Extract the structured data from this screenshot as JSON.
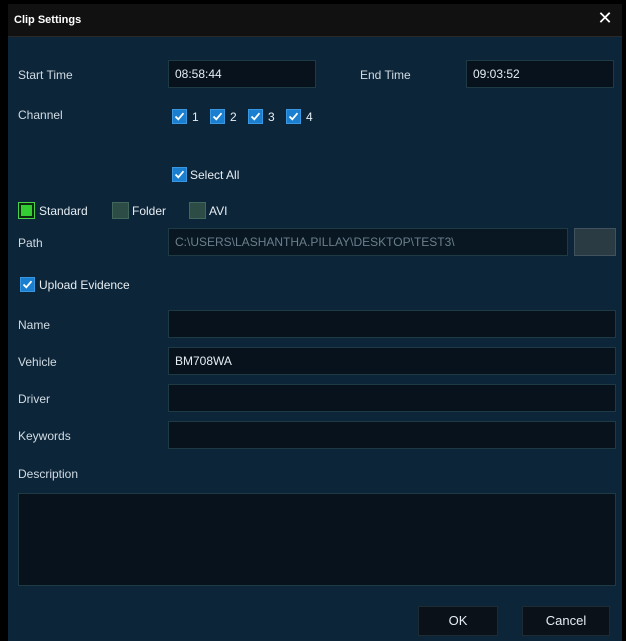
{
  "dialog": {
    "title": "Clip Settings"
  },
  "time": {
    "start_label": "Start Time",
    "start_value": "08:58:44",
    "end_label": "End Time",
    "end_value": "09:03:52"
  },
  "channel": {
    "label": "Channel",
    "items": [
      {
        "label": "1",
        "checked": true
      },
      {
        "label": "2",
        "checked": true
      },
      {
        "label": "3",
        "checked": true
      },
      {
        "label": "4",
        "checked": true
      }
    ],
    "select_all_label": "Select All"
  },
  "format": {
    "options": [
      {
        "label": "Standard",
        "selected": true
      },
      {
        "label": "Folder",
        "selected": false
      },
      {
        "label": "AVI",
        "selected": false
      }
    ]
  },
  "path": {
    "label": "Path",
    "value": "C:\\USERS\\LASHANTHA.PILLAY\\DESKTOP\\TEST3\\"
  },
  "upload_evidence": {
    "label": "Upload Evidence",
    "checked": true
  },
  "fields": {
    "name_label": "Name",
    "name_value": "",
    "vehicle_label": "Vehicle",
    "vehicle_value": "BM708WA",
    "driver_label": "Driver",
    "driver_value": "",
    "keywords_label": "Keywords",
    "keywords_value": "",
    "description_label": "Description",
    "description_value": ""
  },
  "buttons": {
    "ok": "OK",
    "cancel": "Cancel"
  },
  "colors": {
    "background": "#0d2538",
    "checkbox": "#1a7fd0",
    "radio_selected": "#33cc33"
  }
}
